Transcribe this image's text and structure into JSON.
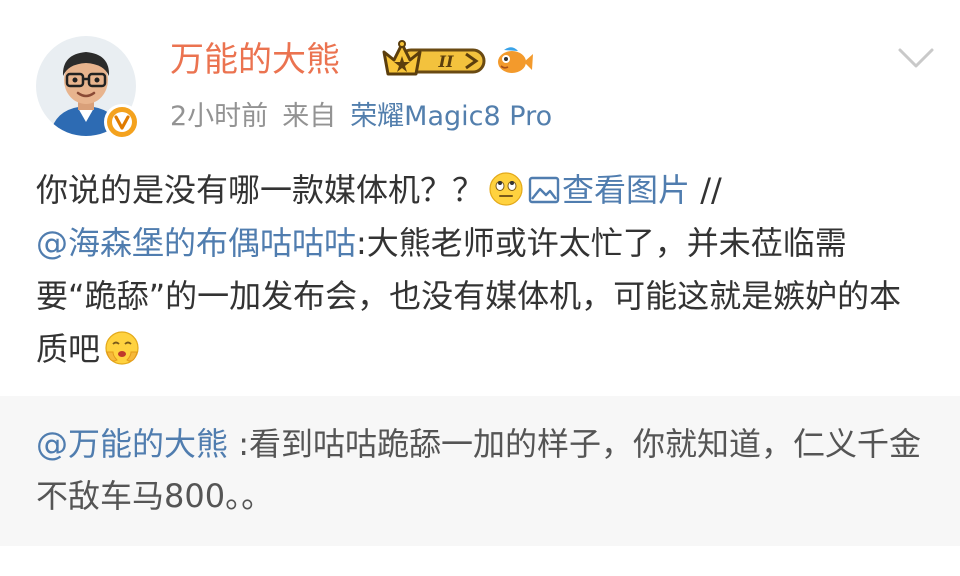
{
  "header": {
    "username": "万能的大熊",
    "time": "2小时前",
    "source_prefix": "来自",
    "device": "荣耀Magic8 Pro",
    "level_badge_text": "II"
  },
  "post": {
    "text_1": "你说的是没有哪一款媒体机？？",
    "view_image_label": "查看图片",
    "separator": "//",
    "mention": "@海森堡的布偶咕咕咕",
    "text_2": ":大熊老师或许太忙了，并未莅临需要“跪舔”的一加发布会，也没有媒体机，可能这就是嫉妒的本质吧"
  },
  "quote": {
    "mention": "@万能的大熊",
    "text": " :看到咕咕跪舔一加的样子，你就知道，仁义千金不敌车马800。。"
  },
  "icons": {
    "verified": "verified-v-icon",
    "level": "crown-level-icon",
    "fan": "fish-fan-icon",
    "more": "chevron-down-icon",
    "image": "image-icon",
    "emoji_1": "eye-roll-emoji",
    "emoji_2": "cover-face-emoji"
  },
  "colors": {
    "username": "#eb7350",
    "link": "#507daf",
    "meta": "#939393",
    "quote_bg": "#f7f7f7"
  }
}
